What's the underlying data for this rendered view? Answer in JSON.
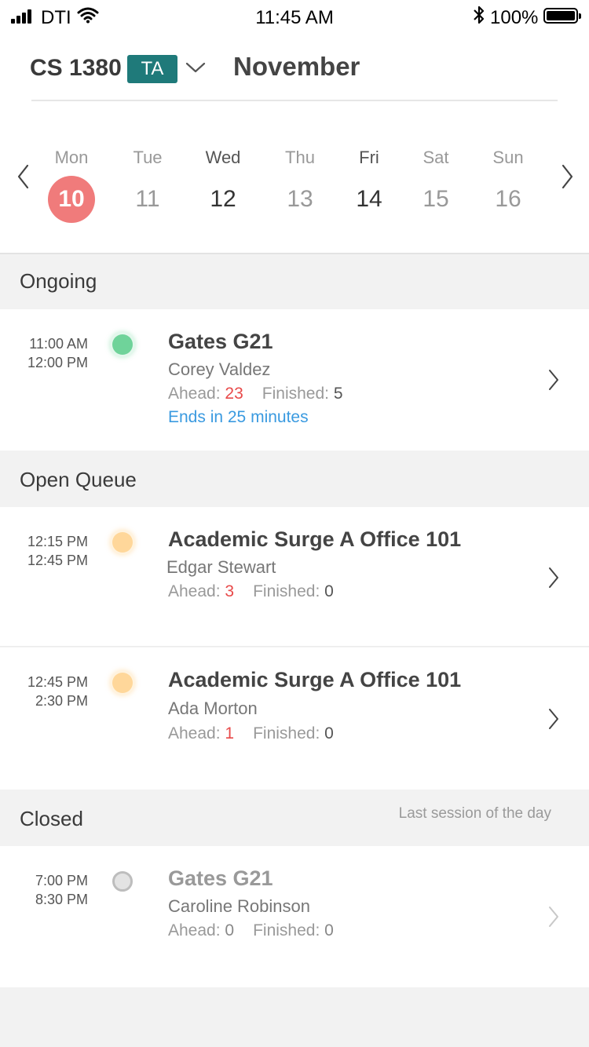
{
  "status_bar": {
    "carrier": "DTI",
    "time": "11:45 AM",
    "battery": "100%"
  },
  "header": {
    "course": "CS 1380",
    "role": "TA",
    "month": "November"
  },
  "week": {
    "days": [
      {
        "name": "Mon",
        "num": "10"
      },
      {
        "name": "Tue",
        "num": "11"
      },
      {
        "name": "Wed",
        "num": "12"
      },
      {
        "name": "Thu",
        "num": "13"
      },
      {
        "name": "Fri",
        "num": "14"
      },
      {
        "name": "Sat",
        "num": "15"
      },
      {
        "name": "Sun",
        "num": "16"
      }
    ]
  },
  "sections": {
    "ongoing": {
      "title": "Ongoing",
      "items": [
        {
          "start": "11:00 AM",
          "end": "12:00 PM",
          "location": "Gates G21",
          "ta": "Corey Valdez",
          "ahead_label": "Ahead:",
          "ahead": "23",
          "finished_label": "Finished:",
          "finished": "5",
          "ends": "Ends in 25 minutes",
          "status_color": "#6fd39a"
        }
      ]
    },
    "open": {
      "title": "Open Queue",
      "items": [
        {
          "start": "12:15 PM",
          "end": "12:45 PM",
          "location": "Academic Surge A Office 101",
          "ta": "Edgar Stewart",
          "ahead_label": "Ahead:",
          "ahead": "3",
          "finished_label": "Finished:",
          "finished": "0",
          "status_color": "#ffd79a"
        },
        {
          "start": "12:45 PM",
          "end": "2:30 PM",
          "location": "Academic Surge A Office 101",
          "ta": "Ada Morton",
          "ahead_label": "Ahead:",
          "ahead": "1",
          "finished_label": "Finished:",
          "finished": "0",
          "status_color": "#ffd79a"
        }
      ]
    },
    "closed": {
      "title": "Closed",
      "note": "Last session of the day",
      "items": [
        {
          "start": "7:00 PM",
          "end": "8:30 PM",
          "location": "Gates G21",
          "ta": "Caroline Robinson",
          "ahead_label": "Ahead:",
          "ahead": "0",
          "finished_label": "Finished:",
          "finished": "0",
          "status_color": "#bdbdbd"
        }
      ]
    }
  },
  "colors": {
    "accent_teal": "#1f7a7a",
    "selected_day": "#f07b7b",
    "alert_red": "#e84a4a",
    "link_blue": "#3a9ae0"
  }
}
